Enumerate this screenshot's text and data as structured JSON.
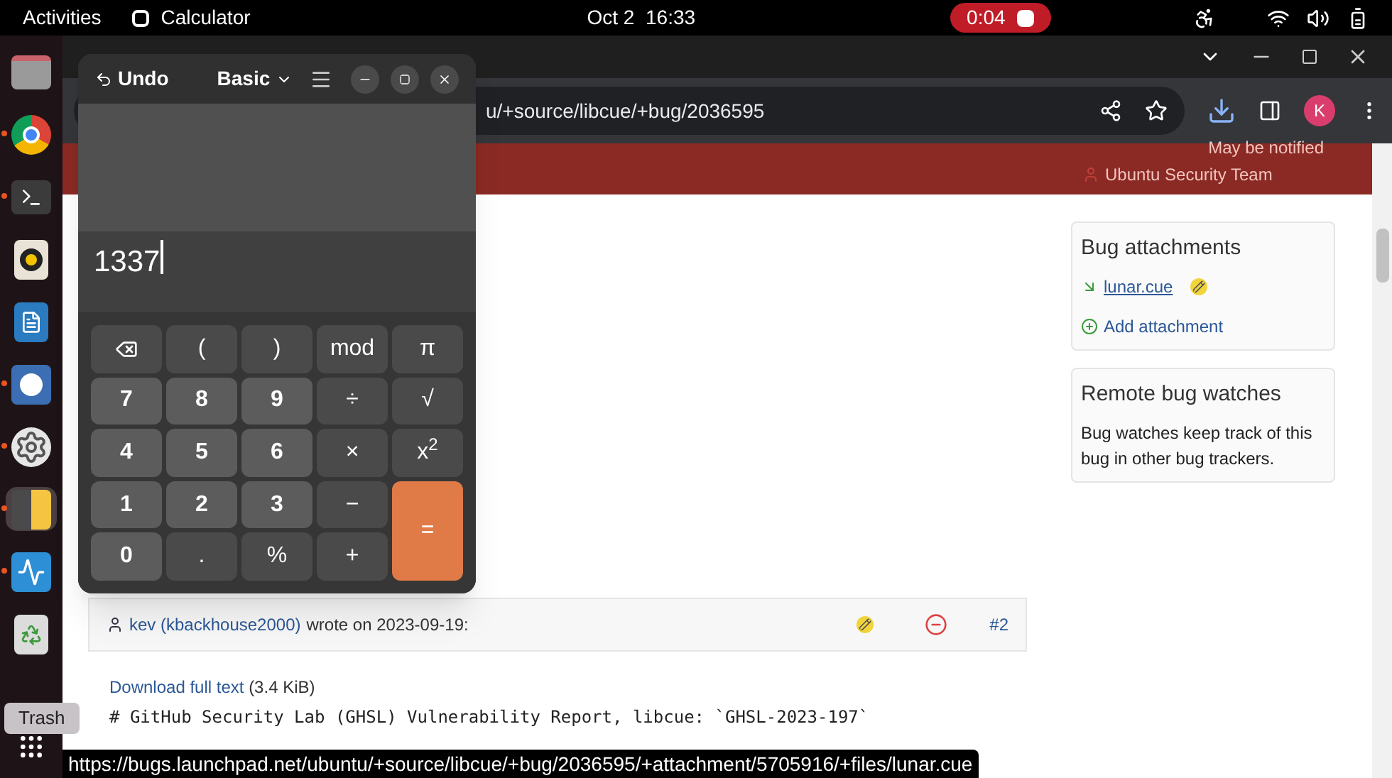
{
  "top_bar": {
    "activities": "Activities",
    "app_name": "Calculator",
    "clock": "Oct 2  16:33",
    "recording": "0:04"
  },
  "dock": {
    "items": [
      {
        "kind": "files",
        "running": false,
        "selected": false
      },
      {
        "kind": "browser",
        "running": true,
        "selected": false
      },
      {
        "kind": "terminal",
        "running": true,
        "selected": false
      },
      {
        "kind": "music",
        "running": false,
        "selected": false
      },
      {
        "kind": "writer",
        "running": false,
        "selected": false
      },
      {
        "kind": "installer",
        "running": true,
        "selected": false
      },
      {
        "kind": "settings",
        "running": true,
        "selected": false
      },
      {
        "kind": "calculator",
        "running": true,
        "selected": true
      },
      {
        "kind": "monitor",
        "running": true,
        "selected": false
      },
      {
        "kind": "trash",
        "running": false,
        "selected": false
      }
    ],
    "tooltip": "Trash"
  },
  "browser": {
    "url": "u/+source/libcue/+bug/2036595",
    "profile": "K"
  },
  "page": {
    "notify_heading": "May be notified",
    "team": "Ubuntu Security Team",
    "attachments": {
      "title": "Bug attachments",
      "files": [
        {
          "name": "lunar.cue"
        }
      ],
      "add": "Add attachment"
    },
    "remote": {
      "title": "Remote bug watches",
      "text": "Bug watches keep track of this bug in other bug trackers."
    },
    "comment": {
      "author": "kev (kbackhouse2000)",
      "wrote": "wrote on 2023-09-19:",
      "number": "#2",
      "download": "Download full text",
      "size": "(3.4 KiB)",
      "body": "# GitHub Security Lab (GHSL) Vulnerability Report, libcue: `GHSL-2023-197`"
    }
  },
  "status_url": "https://bugs.launchpad.net/ubuntu/+source/libcue/+bug/2036595/+attachment/5705916/+files/lunar.cue",
  "calculator": {
    "undo": "Undo",
    "mode": "Basic",
    "display": "1337",
    "keys": [
      {
        "kind": "backspace"
      },
      {
        "kind": "func",
        "label": "("
      },
      {
        "kind": "func",
        "label": ")"
      },
      {
        "kind": "func",
        "label": "mod"
      },
      {
        "kind": "func",
        "label": "π"
      },
      {
        "kind": "digit",
        "label": "7"
      },
      {
        "kind": "digit",
        "label": "8"
      },
      {
        "kind": "digit",
        "label": "9"
      },
      {
        "kind": "func",
        "label": "÷"
      },
      {
        "kind": "func",
        "label": "√"
      },
      {
        "kind": "digit",
        "label": "4"
      },
      {
        "kind": "digit",
        "label": "5"
      },
      {
        "kind": "digit",
        "label": "6"
      },
      {
        "kind": "func",
        "label": "×"
      },
      {
        "kind": "func",
        "label": "x$^{2}$"
      },
      {
        "kind": "digit",
        "label": "1"
      },
      {
        "kind": "digit",
        "label": "2"
      },
      {
        "kind": "digit",
        "label": "3"
      },
      {
        "kind": "func",
        "label": "−"
      },
      {
        "kind": "equals",
        "label": "="
      },
      {
        "kind": "digit",
        "label": "0"
      },
      {
        "kind": "func",
        "label": "."
      },
      {
        "kind": "func",
        "label": "%"
      },
      {
        "kind": "func",
        "label": "+"
      }
    ]
  }
}
